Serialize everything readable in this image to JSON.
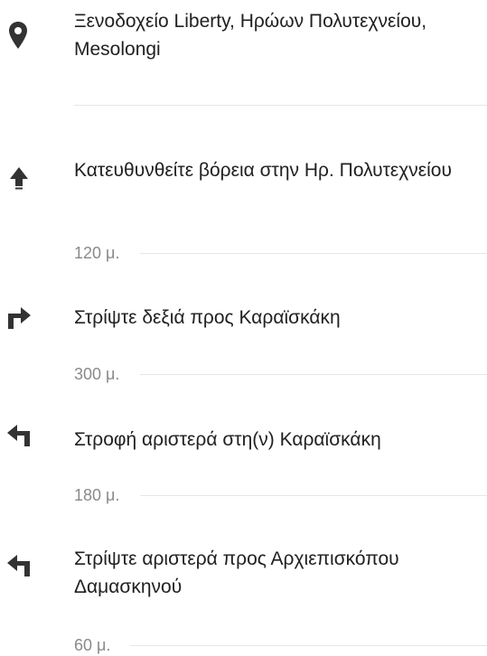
{
  "origin": {
    "icon": "location-pin-icon",
    "address": "Ξενοδοχείο Liberty, Ηρώων Πολυτεχνείου, Mesolongi"
  },
  "steps": [
    {
      "icon": "straight-up-arrow-icon",
      "instruction": "Κατευθυνθείτε βόρεια στην Ηρ. Πολυτεχνείου",
      "distance": "120 μ."
    },
    {
      "icon": "turn-right-arrow-icon",
      "instruction": "Στρίψτε δεξιά προς Καραϊσκάκη",
      "distance": "300 μ."
    },
    {
      "icon": "turn-left-arrow-icon",
      "instruction": "Στροφή αριστερά στη(ν) Καραϊσκάκη",
      "distance": "180 μ."
    },
    {
      "icon": "turn-left-arrow-icon",
      "instruction": "Στρίψτε αριστερά προς Αρχιεπισκόπου Δαμασκηνού",
      "distance": "60 μ."
    }
  ],
  "colors": {
    "text": "#212121",
    "secondary_text": "#8a8a8a",
    "icon": "#333333",
    "divider": "#e6e6e6"
  }
}
